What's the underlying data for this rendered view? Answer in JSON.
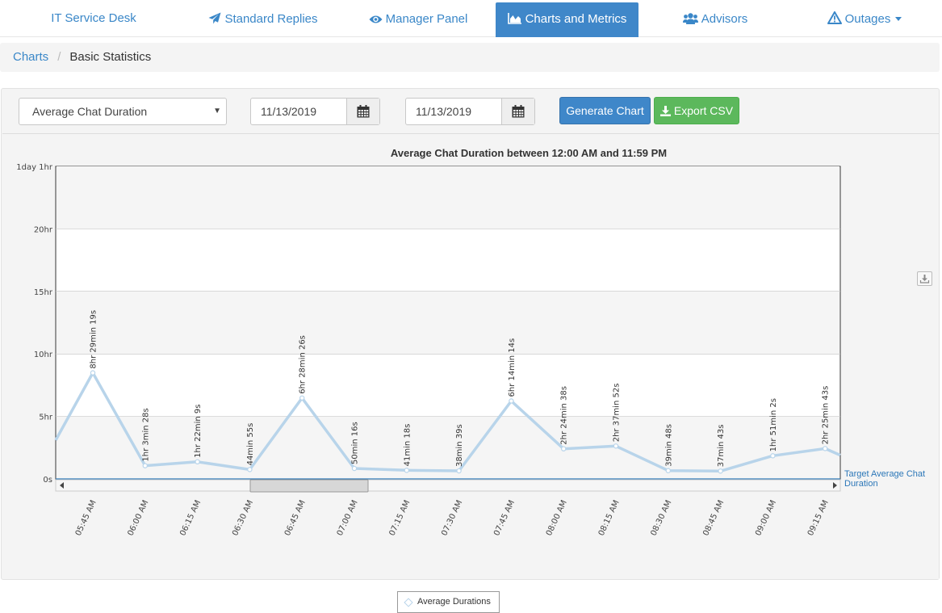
{
  "nav": {
    "brand": "IT Service Desk",
    "items": [
      {
        "label": "Standard Replies",
        "icon": "paper-plane-icon"
      },
      {
        "label": "Manager Panel",
        "icon": "eye-icon"
      },
      {
        "label": "Charts and Metrics",
        "icon": "area-chart-icon",
        "active": true
      },
      {
        "label": "Advisors",
        "icon": "users-icon"
      },
      {
        "label": "Outages",
        "icon": "warning-icon"
      }
    ]
  },
  "breadcrumb": {
    "parent": "Charts",
    "separator": "/",
    "current": "Basic Statistics"
  },
  "controls": {
    "metric_select": "Average Chat Duration",
    "start_date": "11/13/2019",
    "end_date": "11/13/2019",
    "generate_label": "Generate Chart",
    "export_label": "Export CSV"
  },
  "colors": {
    "accent": "#3f87c9",
    "success": "#5cb85c",
    "series": "#b8d4ea",
    "target_line": "#2c77b8"
  },
  "chart_data": {
    "type": "line",
    "title": "Average Chat Duration between 12:00 AM and 11:59 PM",
    "y_ticks": [
      "0s",
      "5hr",
      "10hr",
      "15hr",
      "20hr",
      "1day 1hr"
    ],
    "ylim_hours": [
      0,
      25
    ],
    "x": [
      "05:45 AM",
      "06:00 AM",
      "06:15 AM",
      "06:30 AM",
      "06:45 AM",
      "07:00 AM",
      "07:15 AM",
      "07:30 AM",
      "07:45 AM",
      "08:00 AM",
      "08:15 AM",
      "08:30 AM",
      "08:45 AM",
      "09:00 AM",
      "09:15 AM"
    ],
    "series": [
      {
        "name": "Average Durations",
        "values_hours": [
          8.489,
          1.058,
          1.369,
          0.749,
          6.474,
          0.838,
          0.688,
          0.644,
          6.237,
          2.411,
          2.631,
          0.663,
          0.629,
          1.851,
          2.429
        ],
        "labels": [
          "8hr 29min 19s",
          "1hr 3min 28s",
          "1hr 22min 9s",
          "44min 55s",
          "6hr 28min 26s",
          "50min 16s",
          "41min 18s",
          "38min 39s",
          "6hr 14min 14s",
          "2hr 24min 38s",
          "2hr 37min 52s",
          "39min 48s",
          "37min 43s",
          "1hr 51min 2s",
          "2hr 25min 43s"
        ],
        "edge_left_hours": 3.1,
        "edge_right_hours": 1.9
      }
    ],
    "target_label": "Target Average Chat Duration",
    "legend": "bottom-center",
    "grid": true
  }
}
